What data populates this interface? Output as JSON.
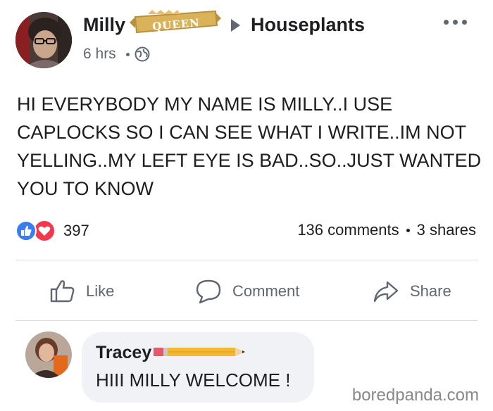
{
  "post": {
    "author": "Milly",
    "badge": "QUEEN",
    "group": "Houseplants",
    "time": "6 hrs",
    "body": "HI EVERYBODY MY NAME IS MILLY..I USE\nCAPLOCKS SO I CAN SEE WHAT I WRITE..IM NOT\nYELLING..MY LEFT EYE IS BAD..SO..JUST WANTED\nYOU TO KNOW",
    "reaction_count": "397",
    "comments": "136 comments",
    "shares": "3 shares"
  },
  "actions": {
    "like": "Like",
    "comment": "Comment",
    "share": "Share"
  },
  "comment": {
    "author": "Tracey",
    "text": "HIII MILLY WELCOME !"
  },
  "watermark": "boredpanda.com",
  "colors": {
    "like_blue": "#3b7cf0",
    "love_red": "#f0394c",
    "secondary_text": "#606770",
    "badge_gold": "#d9b25a"
  },
  "icons": {
    "more": "more-icon",
    "globe": "globe-icon",
    "like": "thumbs-up-icon",
    "comment": "comment-bubble-icon",
    "share": "share-arrow-icon"
  }
}
